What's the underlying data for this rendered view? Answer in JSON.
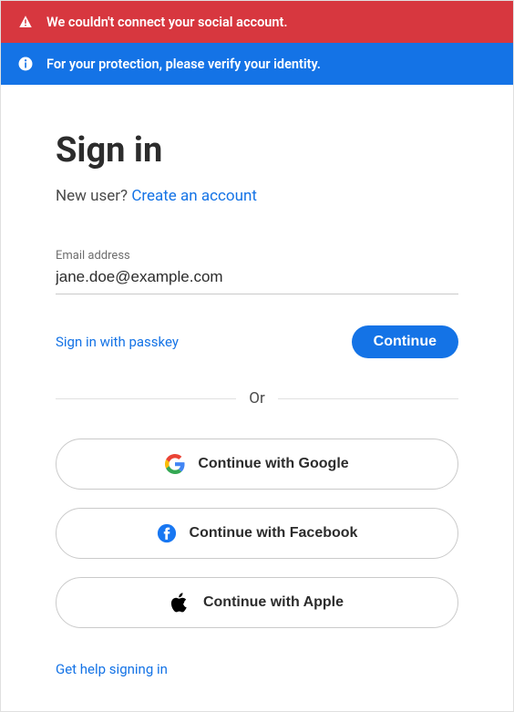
{
  "alerts": {
    "error": "We couldn't connect your social account.",
    "info": "For your protection, please verify your identity."
  },
  "title": "Sign in",
  "newuser": {
    "prefix": "New user? ",
    "link": "Create an account"
  },
  "email": {
    "label": "Email address",
    "value": "jane.doe@example.com"
  },
  "passkey_link": "Sign in with passkey",
  "continue_label": "Continue",
  "divider": "Or",
  "social": {
    "google": "Continue with Google",
    "facebook": "Continue with Facebook",
    "apple": "Continue with Apple"
  },
  "help_link": "Get help signing in"
}
